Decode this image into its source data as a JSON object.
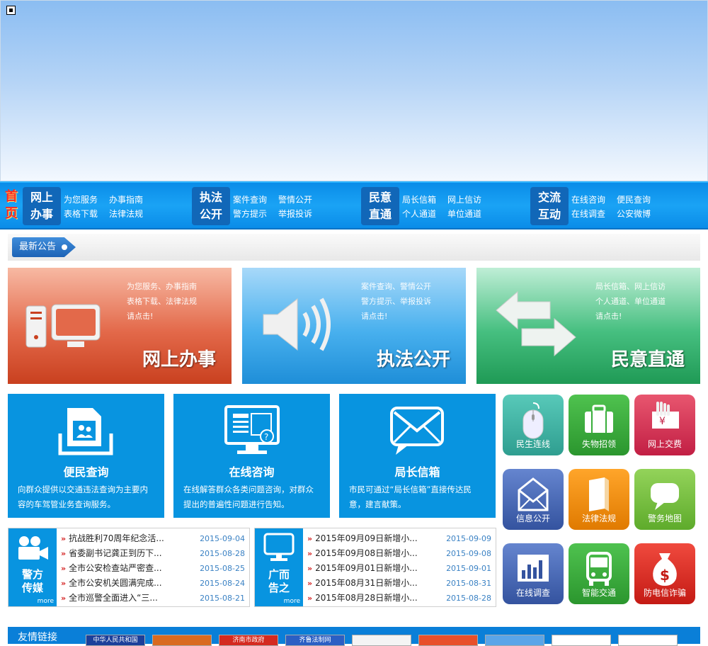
{
  "nav": {
    "home": [
      "首",
      "页"
    ],
    "groups": [
      {
        "title": [
          "网上",
          "办事"
        ],
        "links": [
          "为您服务",
          "办事指南",
          "表格下载",
          "法律法规"
        ]
      },
      {
        "title": [
          "执法",
          "公开"
        ],
        "links": [
          "案件查询",
          "警情公开",
          "警方提示",
          "举报投诉"
        ]
      },
      {
        "title": [
          "民意",
          "直通"
        ],
        "links": [
          "局长信箱",
          "网上信访",
          "个人通道",
          "单位通道"
        ]
      },
      {
        "title": [
          "交流",
          "互动"
        ],
        "links": [
          "在线咨询",
          "便民查询",
          "在线调查",
          "公安微博"
        ]
      }
    ]
  },
  "notice": {
    "label": "最新公告"
  },
  "big_cards": [
    {
      "title": "网上办事",
      "lines": [
        "为您服务、办事指南",
        "表格下载、法律法规",
        "请点击!"
      ],
      "color": "#e06a4b",
      "icon": "computer-icon"
    },
    {
      "title": "执法公开",
      "lines": [
        "案件查询、警情公开",
        "警方提示、举报投诉",
        "请点击!"
      ],
      "color": "#35a6ea",
      "icon": "speaker-icon"
    },
    {
      "title": "民意直通",
      "lines": [
        "局长信箱、网上信访",
        "个人通道、单位通道",
        "请点击!"
      ],
      "color": "#2bb070",
      "icon": "arrows-icon"
    }
  ],
  "mid_cards": [
    {
      "title": "便民查询",
      "desc": "向群众提供以交通违法查询为主要内容的车驾管业务查询服务。",
      "icon": "document-user-icon"
    },
    {
      "title": "在线咨询",
      "desc": "在线解答群众各类问题咨询，对群众提出的普遍性问题进行告知。",
      "icon": "monitor-help-icon"
    },
    {
      "title": "局长信箱",
      "desc": "市民可通过“局长信箱”直接传达民意，建言献策。",
      "icon": "envelope-icon"
    }
  ],
  "tiles": [
    {
      "label": "民生连线",
      "color": "#3fb3a4",
      "icon": "mouse-icon"
    },
    {
      "label": "失物招领",
      "color": "#37ad3a",
      "icon": "briefcase-icon"
    },
    {
      "label": "网上交费",
      "color": "#d8385a",
      "icon": "payment-icon"
    },
    {
      "label": "信息公开",
      "color": "#4c6bb8",
      "icon": "mail-open-icon"
    },
    {
      "label": "法律法规",
      "color": "#f28c10",
      "icon": "book-icon"
    },
    {
      "label": "警务地图",
      "color": "#7cc241",
      "icon": "speech-bubble-icon"
    },
    {
      "label": "在线调查",
      "color": "#4c6bb8",
      "icon": "bar-chart-icon"
    },
    {
      "label": "智能交通",
      "color": "#37ad3a",
      "icon": "bus-icon"
    },
    {
      "label": "防电信诈骗",
      "color": "#e0302b",
      "icon": "money-bag-icon"
    }
  ],
  "news_police": {
    "name": [
      "警方",
      "传媒"
    ],
    "more": "more",
    "items": [
      {
        "title": "抗战胜利70周年纪念活...",
        "date": "2015-09-04"
      },
      {
        "title": "省委副书记龚正到历下...",
        "date": "2015-08-28"
      },
      {
        "title": "全市公安检查站严密查...",
        "date": "2015-08-25"
      },
      {
        "title": "全市公安机关圆满完成...",
        "date": "2015-08-24"
      },
      {
        "title": "全市巡警全面进入“三...",
        "date": "2015-08-21"
      }
    ]
  },
  "news_ads": {
    "name": [
      "广而",
      "告之"
    ],
    "more": "more",
    "items": [
      {
        "title": "2015年09月09日新增小...",
        "date": "2015-09-09"
      },
      {
        "title": "2015年09月08日新增小...",
        "date": "2015-09-08"
      },
      {
        "title": "2015年09月01日新增小...",
        "date": "2015-09-01"
      },
      {
        "title": "2015年08月31日新增小...",
        "date": "2015-08-31"
      },
      {
        "title": "2015年08月28日新增小...",
        "date": "2015-08-28"
      }
    ]
  },
  "friend_links": {
    "label": "友情链接",
    "items": [
      "中华人民共和国",
      "",
      "济南市政府",
      "齐鲁法制网",
      "",
      "",
      "",
      "",
      ""
    ]
  }
}
